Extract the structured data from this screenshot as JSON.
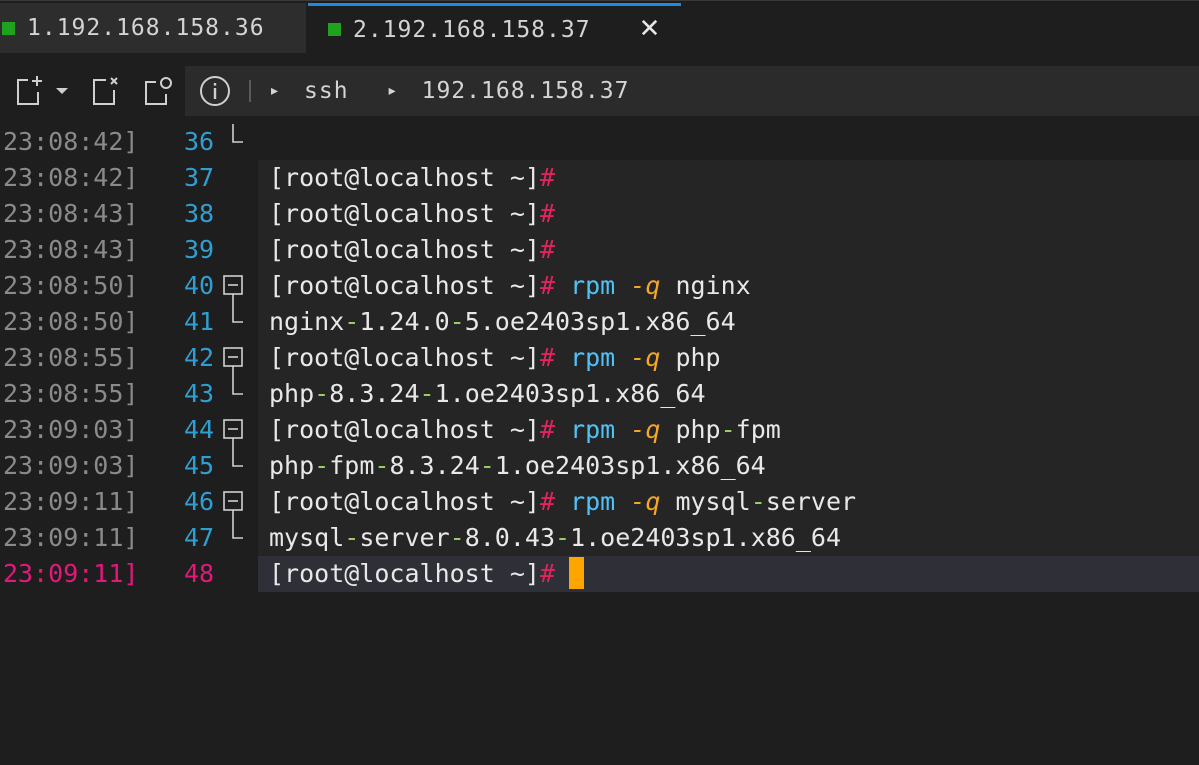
{
  "tabs": [
    {
      "label": "1.192.168.158.36",
      "active": false,
      "status_color": "#1fa31f"
    },
    {
      "label": "2.192.168.158.37",
      "active": true,
      "status_color": "#1fa31f"
    }
  ],
  "toolbar": {
    "icons": [
      "new-tab-icon",
      "dropdown-arrow-icon",
      "close-tab-icon",
      "duplicate-tab-icon"
    ],
    "info_icon": "info-icon",
    "breadcrumb": [
      {
        "arrow": "▸",
        "label": "ssh"
      },
      {
        "arrow": "▸",
        "label": "192.168.158.37"
      }
    ]
  },
  "colors": {
    "accent": "#1e88e5",
    "prompt_hash": "#e0245e",
    "command": "#4fc3f7",
    "option": "#f5a623",
    "hyphen": "#9ccc65",
    "line_number": "#2f9fd3",
    "current_line_marker": "#e5177a",
    "cursor": "#ffa500"
  },
  "terminal": {
    "lines": [
      {
        "time": "23:08:42]",
        "num": "36",
        "gutter": "end",
        "prompt": "",
        "command": "",
        "option": "",
        "arg": "",
        "output": ""
      },
      {
        "time": "23:08:42]",
        "num": "37",
        "gutter": "",
        "prompt": "[root@localhost ~]",
        "command": "",
        "option": "",
        "arg": "",
        "output": ""
      },
      {
        "time": "23:08:43]",
        "num": "38",
        "gutter": "",
        "prompt": "[root@localhost ~]",
        "command": "",
        "option": "",
        "arg": "",
        "output": ""
      },
      {
        "time": "23:08:43]",
        "num": "39",
        "gutter": "",
        "prompt": "[root@localhost ~]",
        "command": "",
        "option": "",
        "arg": "",
        "output": ""
      },
      {
        "time": "23:08:50]",
        "num": "40",
        "gutter": "fold",
        "prompt": "[root@localhost ~]",
        "command": "rpm",
        "option": "-q",
        "arg": "nginx",
        "output": ""
      },
      {
        "time": "23:08:50]",
        "num": "41",
        "gutter": "end",
        "prompt": "",
        "command": "",
        "option": "",
        "arg": "",
        "output": "nginx-1.24.0-5.oe2403sp1.x86_64"
      },
      {
        "time": "23:08:55]",
        "num": "42",
        "gutter": "fold",
        "prompt": "[root@localhost ~]",
        "command": "rpm",
        "option": "-q",
        "arg": "php",
        "output": ""
      },
      {
        "time": "23:08:55]",
        "num": "43",
        "gutter": "end",
        "prompt": "",
        "command": "",
        "option": "",
        "arg": "",
        "output": "php-8.3.24-1.oe2403sp1.x86_64"
      },
      {
        "time": "23:09:03]",
        "num": "44",
        "gutter": "fold",
        "prompt": "[root@localhost ~]",
        "command": "rpm",
        "option": "-q",
        "arg": "php-fpm",
        "output": ""
      },
      {
        "time": "23:09:03]",
        "num": "45",
        "gutter": "end",
        "prompt": "",
        "command": "",
        "option": "",
        "arg": "",
        "output": "php-fpm-8.3.24-1.oe2403sp1.x86_64"
      },
      {
        "time": "23:09:11]",
        "num": "46",
        "gutter": "fold",
        "prompt": "[root@localhost ~]",
        "command": "rpm",
        "option": "-q",
        "arg": "mysql-server",
        "output": ""
      },
      {
        "time": "23:09:11]",
        "num": "47",
        "gutter": "end",
        "prompt": "",
        "command": "",
        "option": "",
        "arg": "",
        "output": "mysql-server-8.0.43-1.oe2403sp1.x86_64"
      },
      {
        "time": "23:09:11]",
        "num": "48",
        "gutter": "",
        "prompt": "[root@localhost ~]",
        "command": "",
        "option": "",
        "arg": "",
        "output": "",
        "current": true
      }
    ]
  }
}
